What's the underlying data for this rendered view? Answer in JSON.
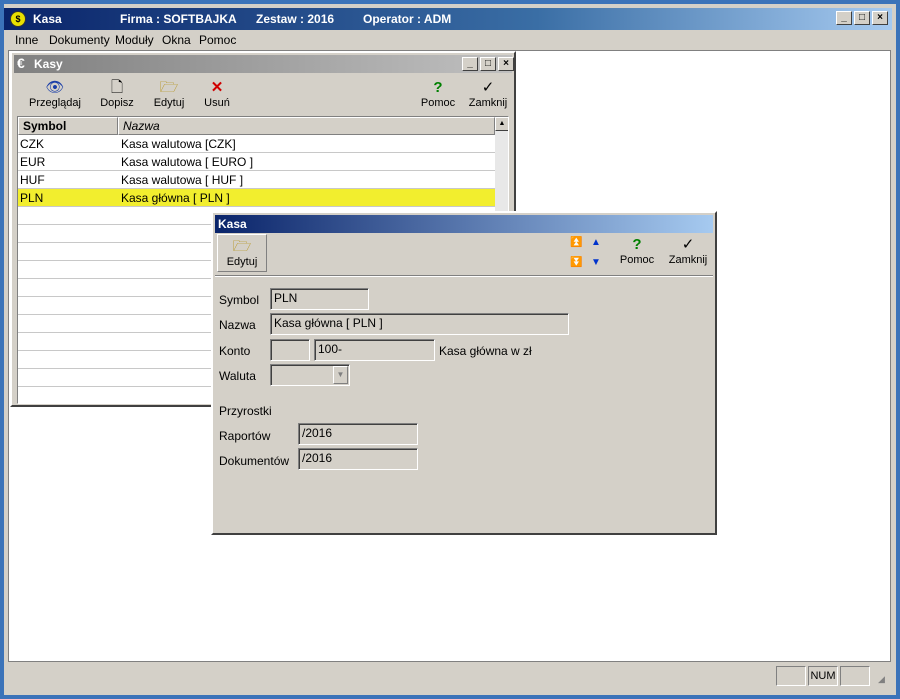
{
  "app": {
    "title": "Kasa",
    "firma": "Firma : SOFTBAJKA",
    "zestaw": "Zestaw : 2016",
    "operator": "Operator : ADM"
  },
  "menu": [
    "Inne",
    "Dokumenty",
    "Moduły",
    "Okna",
    "Pomoc"
  ],
  "kasy_window": {
    "title": "Kasy",
    "toolbar": {
      "przegladaj": "Przeglądaj",
      "dopisz": "Dopisz",
      "edytuj": "Edytuj",
      "usun": "Usuń",
      "pomoc": "Pomoc",
      "zamknij": "Zamknij"
    },
    "columns": [
      "Symbol",
      "Nazwa"
    ],
    "rows": [
      {
        "symbol": "CZK",
        "nazwa": "Kasa walutowa [CZK]"
      },
      {
        "symbol": "EUR",
        "nazwa": "Kasa walutowa [ EURO ]"
      },
      {
        "symbol": "HUF",
        "nazwa": "Kasa walutowa [ HUF ]"
      },
      {
        "symbol": "PLN",
        "nazwa": "Kasa główna [ PLN ]"
      }
    ],
    "selected_row": 3
  },
  "kasa_dialog": {
    "title": "Kasa",
    "toolbar": {
      "edytuj": "Edytuj",
      "pomoc": "Pomoc",
      "zamknij": "Zamknij"
    },
    "labels": {
      "symbol": "Symbol",
      "nazwa": "Nazwa",
      "konto": "Konto",
      "waluta": "Waluta",
      "przyrostki": "Przyrostki",
      "raportow": "Raportów",
      "dokumentow": "Dokumentów"
    },
    "values": {
      "symbol": "PLN",
      "nazwa": "Kasa główna [ PLN ]",
      "konto_prefix": "",
      "konto": "100-",
      "konto_desc": "Kasa główna w zł",
      "waluta": "",
      "raportow": "/2016",
      "dokumentow": "/2016"
    }
  },
  "status": {
    "num": "NUM"
  },
  "colors": {
    "selected_row": "#f2ee2e",
    "titlebar_active": "#0a246a",
    "face": "#d4d0c8"
  }
}
